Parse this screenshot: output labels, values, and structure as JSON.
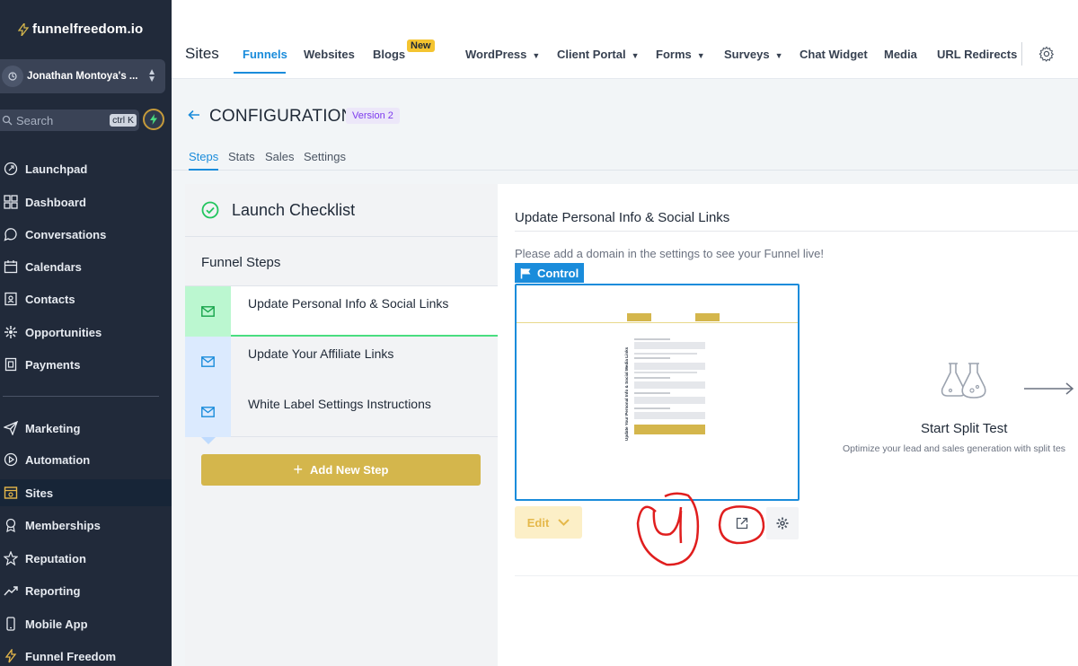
{
  "sidebar": {
    "logo": "funnelfreedom.io",
    "account_name": "Jonathan Montoya's ...",
    "search_placeholder": "Search",
    "search_shortcut": "ctrl K",
    "items": [
      {
        "label": "Launchpad",
        "icon": "rocket-icon"
      },
      {
        "label": "Dashboard",
        "icon": "grid-icon"
      },
      {
        "label": "Conversations",
        "icon": "chat-icon"
      },
      {
        "label": "Calendars",
        "icon": "calendar-icon"
      },
      {
        "label": "Contacts",
        "icon": "contacts-icon"
      },
      {
        "label": "Opportunities",
        "icon": "opportunities-icon"
      },
      {
        "label": "Payments",
        "icon": "payments-icon"
      },
      {
        "label": "Marketing",
        "icon": "send-icon"
      },
      {
        "label": "Automation",
        "icon": "automation-icon"
      },
      {
        "label": "Sites",
        "icon": "sites-icon",
        "active": true
      },
      {
        "label": "Memberships",
        "icon": "badge-icon"
      },
      {
        "label": "Reputation",
        "icon": "star-icon"
      },
      {
        "label": "Reporting",
        "icon": "trend-icon"
      },
      {
        "label": "Mobile App",
        "icon": "mobile-icon"
      },
      {
        "label": "Funnel Freedom",
        "icon": "bolt-icon"
      }
    ]
  },
  "topbar": {
    "title": "Sites",
    "nav": [
      {
        "label": "Funnels",
        "active": true
      },
      {
        "label": "Websites"
      },
      {
        "label": "Blogs",
        "badge": "New"
      },
      {
        "label": "WordPress",
        "dropdown": true
      },
      {
        "label": "Client Portal",
        "dropdown": true
      },
      {
        "label": "Forms",
        "dropdown": true
      },
      {
        "label": "Surveys",
        "dropdown": true
      },
      {
        "label": "Chat Widget"
      },
      {
        "label": "Media"
      },
      {
        "label": "URL Redirects"
      }
    ]
  },
  "config": {
    "title": "CONFIGURATION",
    "version": "Version 2",
    "tabs": [
      "Steps",
      "Stats",
      "Sales",
      "Settings"
    ],
    "active_tab": "Steps"
  },
  "steps_panel": {
    "checklist_title": "Launch Checklist",
    "funnel_steps_label": "Funnel Steps",
    "steps": [
      {
        "label": "Update Personal Info & Social Links",
        "active": true
      },
      {
        "label": "Update Your Affiliate Links"
      },
      {
        "label": "White Label Settings Instructions"
      }
    ],
    "add_step_label": "Add New Step"
  },
  "detail": {
    "step_title": "Update Personal Info & Social Links",
    "domain_note": "Please add a domain in the settings to see your Funnel live!",
    "control_label": "Control",
    "edit_label": "Edit",
    "preview_heading": "Update Your Personal Info & Social Media Links",
    "split_test_title": "Start Split Test",
    "split_test_desc": "Optimize your lead and sales generation with split tes"
  },
  "colors": {
    "sidebar_bg": "#212a3a",
    "accent_blue": "#1a8cdb",
    "gold": "#d4b64c",
    "success_green": "#22c55e",
    "annotation_red": "#e01e1e"
  }
}
